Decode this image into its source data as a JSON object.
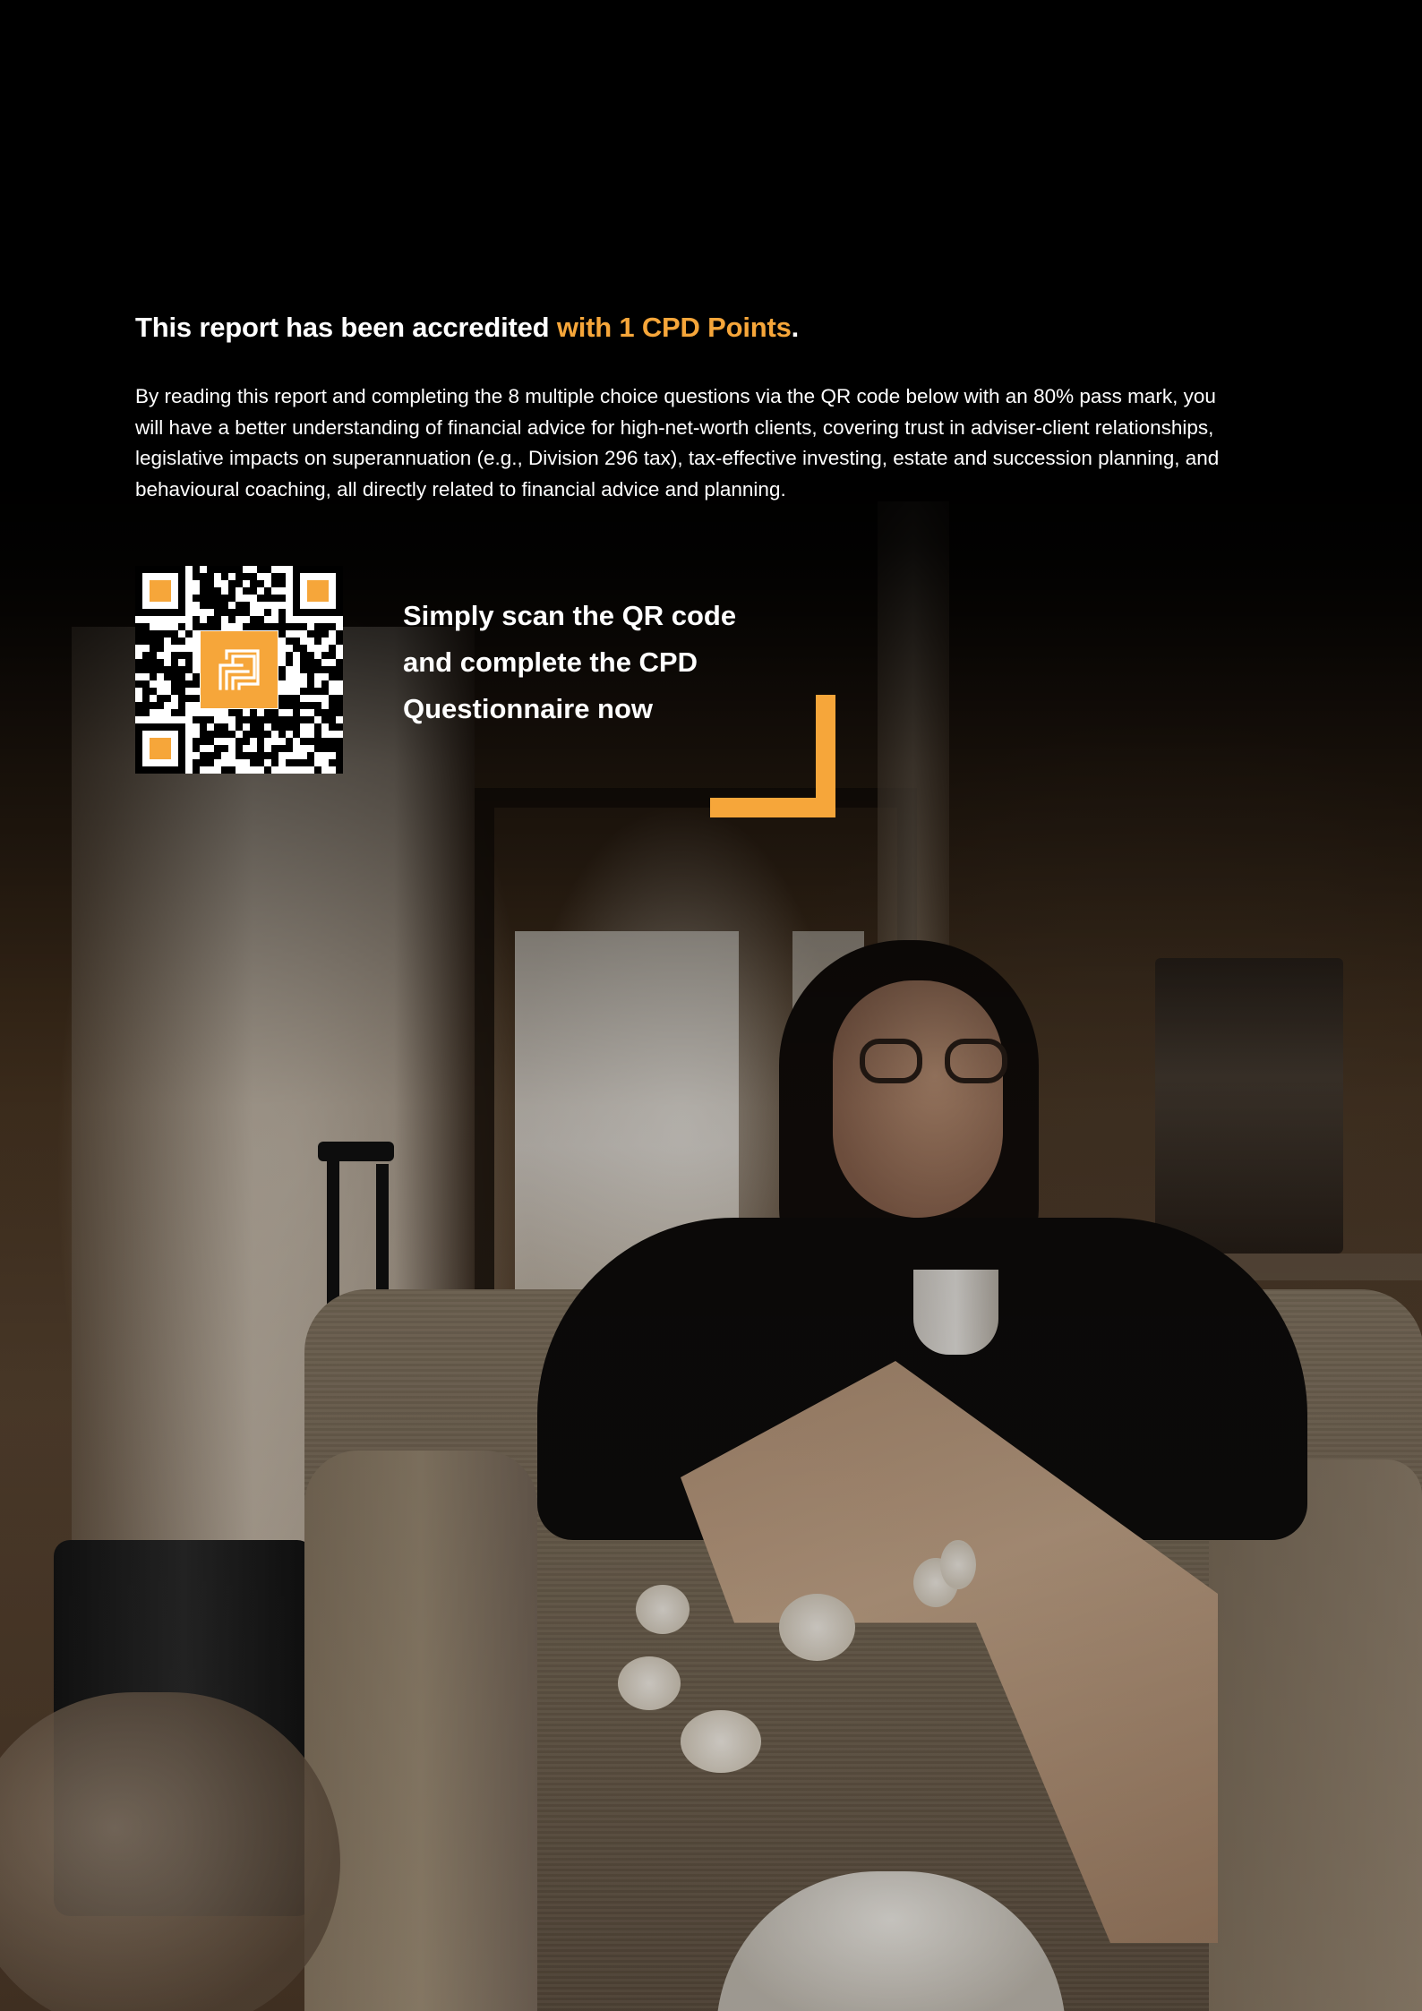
{
  "accreditation": {
    "heading_prefix": "This report has been accredited ",
    "heading_accent": "with 1 CPD Points",
    "heading_suffix": ".",
    "body": "By reading this report and completing the 8 multiple choice questions via the QR code below with an 80% pass mark, you will have a better understanding of financial advice for high-net-worth clients, covering trust in adviser-client relationships, legislative impacts on superannuation (e.g., Division 296 tax), tax-effective investing, estate and succession planning, and behavioural coaching, all directly related to financial advice and planning."
  },
  "cta": {
    "line1": "Simply scan the QR code",
    "line2": "and complete the CPD",
    "line3": "Questionnaire now"
  },
  "qr": {
    "icon": "qr-code-icon",
    "center_icon": "brand-logo-icon"
  },
  "colors": {
    "accent": "#f6a63a",
    "background": "#000000",
    "text": "#ffffff"
  },
  "background_image": {
    "icon": "photo-woman-in-armchair-with-coffee"
  }
}
